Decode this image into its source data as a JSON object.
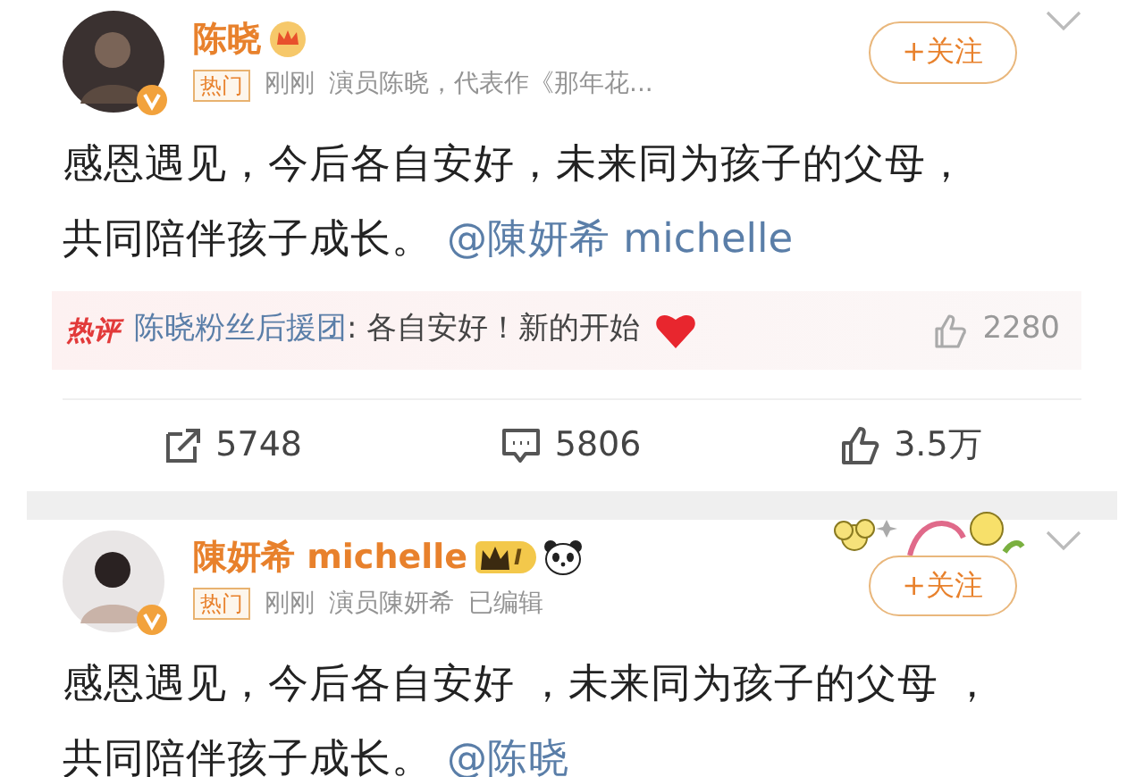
{
  "posts": [
    {
      "author": {
        "name": "陈晓",
        "badges": [
          {
            "kind": "crown"
          }
        ]
      },
      "hot_tag": "热门",
      "meta": [
        "刚刚",
        "演员陈晓，代表作《那年花..."
      ],
      "follow": "+关注",
      "sticker": false,
      "body_lines": [
        "感恩遇见，今后各自安好，未来同为孩子的父母，",
        "共同陪伴孩子成长。"
      ],
      "mention": "@陳妍希 michelle",
      "hot_comment": {
        "label": "热评",
        "user": "陈晓粉丝后援团",
        "text": ": 各自安好！新的开始",
        "likes": "2280"
      },
      "actions": [
        {
          "kind": "repost",
          "count": "5748"
        },
        {
          "kind": "comment",
          "count": "5806"
        },
        {
          "kind": "like",
          "count": "3.5万"
        }
      ]
    },
    {
      "author": {
        "name": "陳妍希 michelle",
        "badges": [
          {
            "kind": "level",
            "text": "I"
          },
          {
            "kind": "panda"
          }
        ]
      },
      "hot_tag": "热门",
      "meta": [
        "刚刚",
        "演员陳妍希",
        "已编辑"
      ],
      "follow": "+关注",
      "sticker": true,
      "body_lines": [
        "感恩遇见，今后各自安好 ，未来同为孩子的父母 ，",
        "共同陪伴孩子成长。"
      ],
      "mention": "@陈晓"
    }
  ]
}
